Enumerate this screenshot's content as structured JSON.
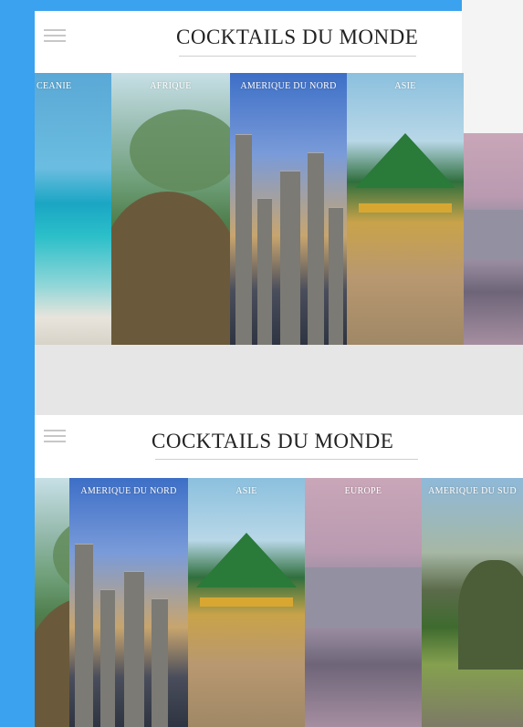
{
  "header_top": {
    "title": "COCKTAILS DU MONDE",
    "menu_icon": "hamburger-icon"
  },
  "strip_top": {
    "panels": [
      {
        "label": "CEANIE"
      },
      {
        "label": "AFRIQUE"
      },
      {
        "label": "AMERIQUE DU NORD"
      },
      {
        "label": "ASIE"
      },
      {
        "label": ""
      }
    ]
  },
  "header_bottom": {
    "title": "COCKTAILS DU MONDE",
    "menu_icon": "hamburger-icon"
  },
  "strip_bottom": {
    "panels": [
      {
        "label": ""
      },
      {
        "label": "AMERIQUE DU NORD"
      },
      {
        "label": "ASIE"
      },
      {
        "label": "EUROPE"
      },
      {
        "label": "AMERIQUE DU SUD"
      }
    ]
  },
  "colors": {
    "background": "#e6e6e6",
    "blue_frame": "#3aa2ee",
    "header_bg": "#ffffff"
  }
}
